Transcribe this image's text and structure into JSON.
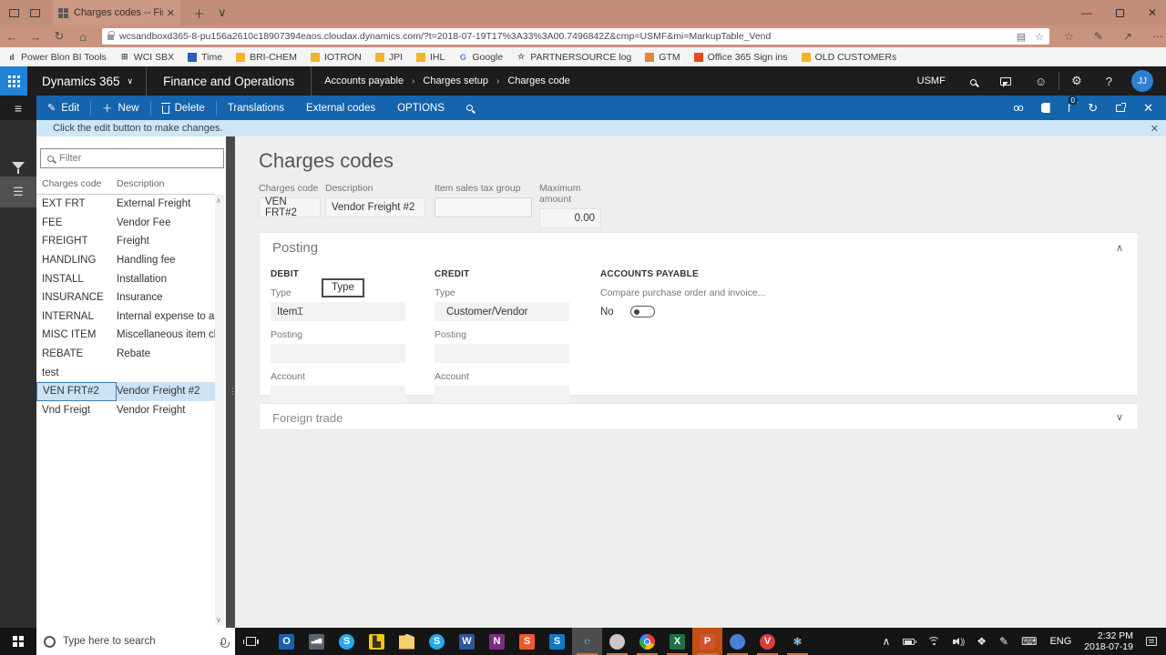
{
  "browser": {
    "tab_title": "Charges codes -- Finan",
    "url_scheme": "https://",
    "url": "wcsandboxd365-8-pu156a2610c18907394eaos.cloudax.dynamics.com/?t=2018-07-19T17%3A33%3A00.7496842Z&cmp=USMF&mi=MarkupTable_Vend",
    "bookmarks": [
      {
        "label": "Power Blon BI Tools",
        "glyph": "ıl",
        "bg": "transparent",
        "fg": "#444"
      },
      {
        "label": "WCI SBX",
        "glyph": "⊞",
        "bg": "transparent",
        "fg": "#666"
      },
      {
        "label": "Time",
        "glyph": "",
        "bg": "#2b5fb4",
        "fg": "#fff"
      },
      {
        "label": "BRI-CHEM",
        "glyph": "",
        "bg": "#f0b429",
        "fg": "#fff"
      },
      {
        "label": "IOTRON",
        "glyph": "",
        "bg": "#f0b429",
        "fg": "#fff"
      },
      {
        "label": "JPI",
        "glyph": "",
        "bg": "#f0b429",
        "fg": "#fff"
      },
      {
        "label": "IHL",
        "glyph": "",
        "bg": "#f0b429",
        "fg": "#fff"
      },
      {
        "label": "Google",
        "glyph": "G",
        "bg": "transparent",
        "fg": "#4285f4"
      },
      {
        "label": "PARTNERSOURCE log",
        "glyph": "☆",
        "bg": "transparent",
        "fg": "#555"
      },
      {
        "label": "GTM",
        "glyph": "",
        "bg": "#e8833a",
        "fg": "#fff"
      },
      {
        "label": "Office 365 Sign ins",
        "glyph": "",
        "bg": "#e64a19",
        "fg": "#fff"
      },
      {
        "label": "OLD CUSTOMERs",
        "glyph": "",
        "bg": "#f0b429",
        "fg": "#fff"
      }
    ]
  },
  "d365": {
    "product": "Dynamics 365",
    "app": "Finance and Operations",
    "breadcrumb": {
      "b1": "Accounts payable",
      "b2": "Charges setup",
      "b3": "Charges code"
    },
    "company": "USMF",
    "avatar_initials": "JJ",
    "actions": {
      "edit": "Edit",
      "new": "New",
      "delete": "Delete",
      "translations": "Translations",
      "external_codes": "External codes",
      "options": "OPTIONS"
    },
    "flag_badge": "0",
    "notification": "Click the edit button to make changes."
  },
  "list": {
    "filter_placeholder": "Filter",
    "col_code": "Charges code",
    "col_desc": "Description",
    "rows": [
      {
        "code": "EXT FRT",
        "desc": "External Freight"
      },
      {
        "code": "FEE",
        "desc": "Vendor Fee"
      },
      {
        "code": "FREIGHT",
        "desc": "Freight"
      },
      {
        "code": "HANDLING",
        "desc": "Handling fee"
      },
      {
        "code": "INSTALL",
        "desc": "Installation"
      },
      {
        "code": "INSURANCE",
        "desc": "Insurance"
      },
      {
        "code": "INTERNAL",
        "desc": "Internal expense to a l..."
      },
      {
        "code": "MISC ITEM",
        "desc": "Miscellaneous item ch..."
      },
      {
        "code": "REBATE",
        "desc": "Rebate"
      },
      {
        "code": "test",
        "desc": ""
      },
      {
        "code": "VEN FRT#2",
        "desc": "Vendor Freight #2",
        "selected": true
      },
      {
        "code": "Vnd Freigt",
        "desc": "Vendor Freight"
      }
    ]
  },
  "main": {
    "title": "Charges codes",
    "fields": {
      "charges_code": {
        "label": "Charges code",
        "value": "VEN FRT#2"
      },
      "description": {
        "label": "Description",
        "value": "Vendor Freight #2"
      },
      "item_sales_tax_group": {
        "label": "Item sales tax group",
        "value": ""
      },
      "maximum_amount": {
        "label": "Maximum amount",
        "value": "0.00"
      }
    },
    "posting": {
      "title": "Posting",
      "tooltip": "Type",
      "debit": {
        "header": "DEBIT",
        "type_label": "Type",
        "type_value": "Item",
        "posting_label": "Posting",
        "posting_value": "",
        "account_label": "Account",
        "account_value": ""
      },
      "credit": {
        "header": "CREDIT",
        "type_label": "Type",
        "type_value": "Customer/Vendor",
        "posting_label": "Posting",
        "posting_value": "",
        "account_label": "Account",
        "account_value": ""
      },
      "accounts_payable": {
        "header": "ACCOUNTS PAYABLE",
        "compare_label": "Compare purchase order and invoice...",
        "toggle_value": "No"
      }
    },
    "foreign_trade_title": "Foreign trade"
  },
  "taskbar": {
    "search_placeholder": "Type here to search",
    "apps": [
      {
        "name": "outlook",
        "glyph": "O",
        "bg": "#1763ad",
        "shape": ""
      },
      {
        "name": "dynamics-chart-app",
        "glyph": "▃▅▇",
        "bg": "#5a6472",
        "shape": "",
        "small": true
      },
      {
        "name": "skype",
        "glyph": "S",
        "bg": "#29a9ea",
        "shape": "ico-ci"
      },
      {
        "name": "power-bi",
        "glyph": "▙",
        "bg": "#f2c811",
        "shape": "",
        "fg": "#3a3228"
      },
      {
        "name": "file-explorer",
        "glyph": "",
        "bg": "#f8ce73",
        "shape": "ico-folder"
      },
      {
        "name": "skype-2",
        "glyph": "S",
        "bg": "#29a9ea",
        "shape": "ico-ci"
      },
      {
        "name": "word",
        "glyph": "W",
        "bg": "#2b579a",
        "shape": ""
      },
      {
        "name": "onenote",
        "glyph": "N",
        "bg": "#7b2d83",
        "shape": ""
      },
      {
        "name": "sumatra-pdf",
        "glyph": "S",
        "bg": "#f0582b",
        "shape": ""
      },
      {
        "name": "skype-for-business",
        "glyph": "S",
        "bg": "#1079c4",
        "shape": ""
      },
      {
        "name": "edge",
        "glyph": "℮",
        "bg": "transparent",
        "fg": "#4ca6e8",
        "slot": "#4d4d4d",
        "run": true,
        "shape": ""
      },
      {
        "name": "mouse-utility",
        "glyph": "",
        "bg": "#cfc4c6",
        "shape": "ico-ci",
        "run": true
      },
      {
        "name": "chrome",
        "glyph": "",
        "bg": "conic-gradient(#ea4335 0 30%, #fbbc05 30% 55%, #34a853 55% 80%, #4285f4 80% 100%)",
        "shape": "ico-ci chrome",
        "run": true
      },
      {
        "name": "excel",
        "glyph": "X",
        "bg": "#1f7145",
        "shape": "",
        "run": true
      },
      {
        "name": "powerpoint",
        "glyph": "P",
        "bg": "#d35230",
        "slot": "#c25012",
        "shape": "",
        "run": true
      },
      {
        "name": "blue-circle-app",
        "glyph": "",
        "bg": "#4a7fd6",
        "shape": "ico-ci",
        "run": true
      },
      {
        "name": "expressvpn",
        "glyph": "V",
        "bg": "#da3d3d",
        "shape": "ico-ci",
        "run": true
      },
      {
        "name": "snowflake-app",
        "glyph": "✻",
        "bg": "transparent",
        "fg": "#8fc3ee",
        "shape": "",
        "run": true
      }
    ],
    "tray": {
      "lang": "ENG",
      "time": "2:32 PM",
      "date": "2018-07-19"
    }
  }
}
